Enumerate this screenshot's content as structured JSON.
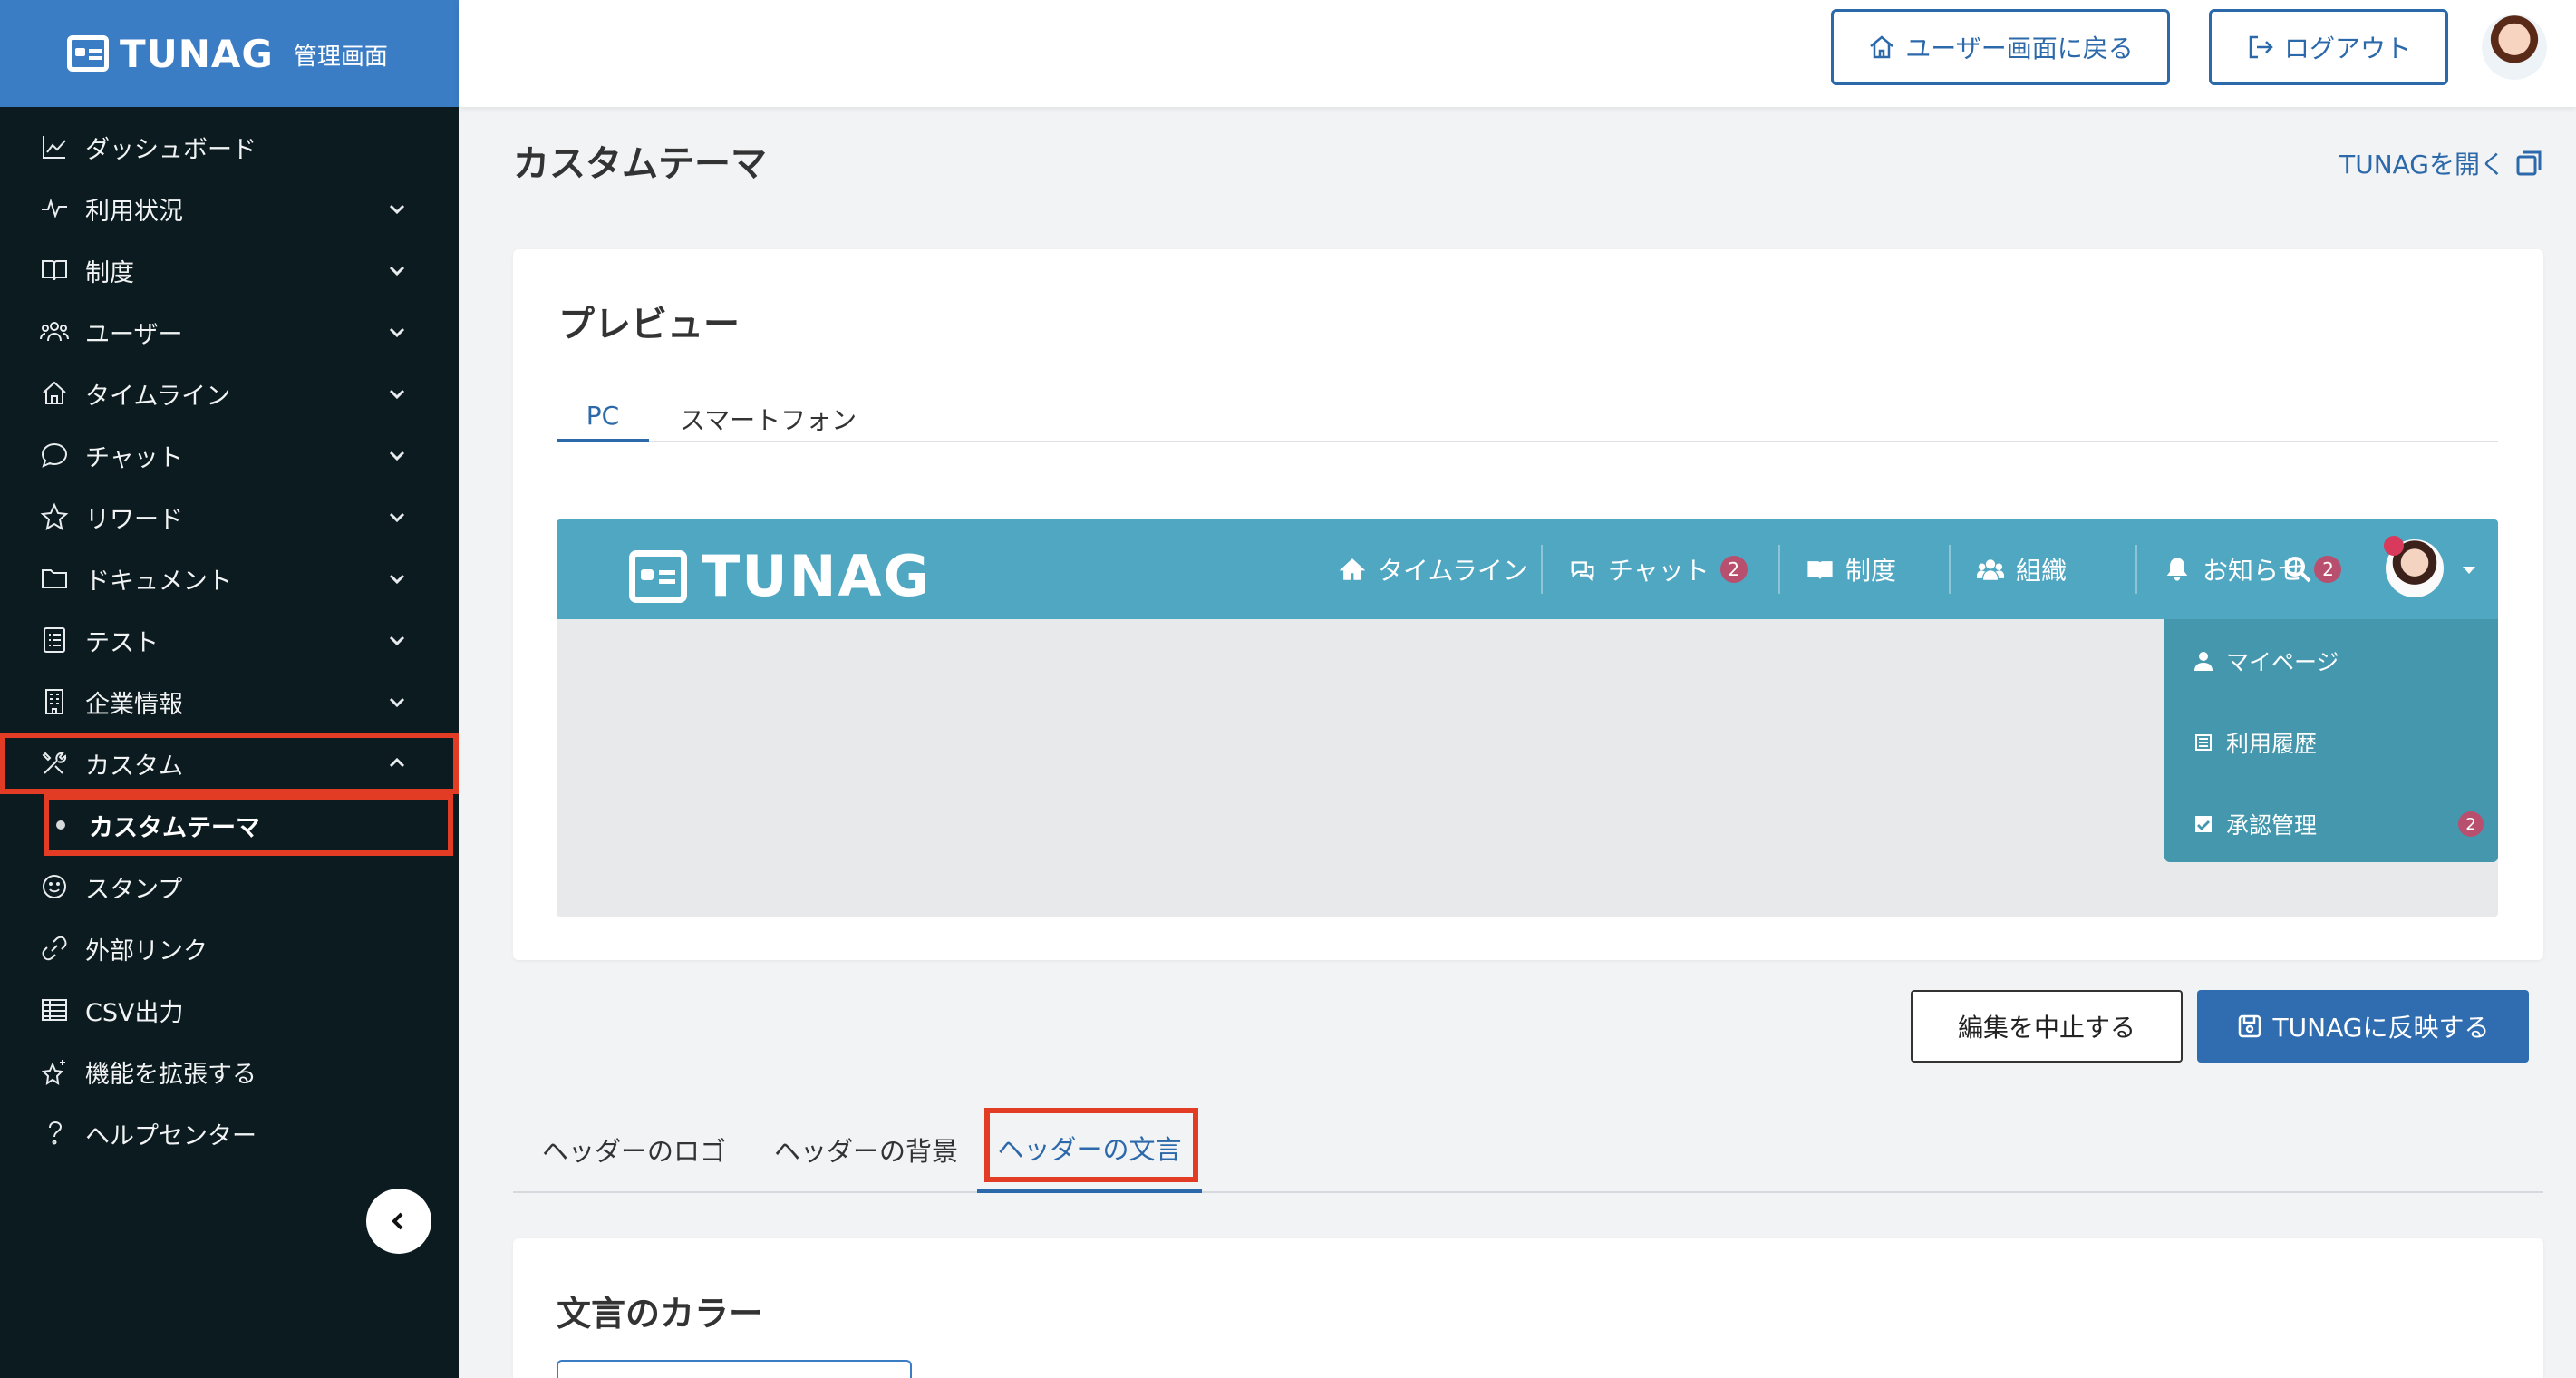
{
  "brand": {
    "logo": "TUNAG",
    "subtitle": "管理画面"
  },
  "sidebar": {
    "items": [
      {
        "label": "ダッシュボード",
        "icon": "chart-line-icon",
        "expandable": false
      },
      {
        "label": "利用状況",
        "icon": "pulse-icon",
        "expandable": true
      },
      {
        "label": "制度",
        "icon": "book-icon",
        "expandable": true
      },
      {
        "label": "ユーザー",
        "icon": "users-icon",
        "expandable": true
      },
      {
        "label": "タイムライン",
        "icon": "home-icon",
        "expandable": true
      },
      {
        "label": "チャット",
        "icon": "chat-bubble-icon",
        "expandable": true
      },
      {
        "label": "リワード",
        "icon": "star-icon",
        "expandable": true
      },
      {
        "label": "ドキュメント",
        "icon": "folder-icon",
        "expandable": true
      },
      {
        "label": "テスト",
        "icon": "checklist-icon",
        "expandable": true
      },
      {
        "label": "企業情報",
        "icon": "building-icon",
        "expandable": true
      },
      {
        "label": "カスタム",
        "icon": "tools-icon",
        "expandable": true,
        "expanded": true
      },
      {
        "label": "スタンプ",
        "icon": "smile-icon",
        "expandable": false
      },
      {
        "label": "外部リンク",
        "icon": "link-icon",
        "expandable": false
      },
      {
        "label": "CSV出力",
        "icon": "table-icon",
        "expandable": false
      },
      {
        "label": "機能を拡張する",
        "icon": "sparkle-star-icon",
        "expandable": false
      },
      {
        "label": "ヘルプセンター",
        "icon": "question-icon",
        "expandable": false
      }
    ],
    "active_sub": "カスタムテーマ"
  },
  "topbar": {
    "user_screen_label": "ユーザー画面に戻る",
    "logout_label": "ログアウト"
  },
  "page": {
    "title": "カスタムテーマ",
    "open_link": "TUNAGを開く"
  },
  "preview": {
    "title": "プレビュー",
    "tabs": [
      "PC",
      "スマートフォン"
    ],
    "active_tab": "PC",
    "mock": {
      "logo": "TUNAG",
      "header_color": "#50a7c2",
      "menu_color": "#4597ad",
      "nav": [
        {
          "label": "タイムライン",
          "icon": "home-icon"
        },
        {
          "label": "チャット",
          "icon": "chat-icon",
          "badge": "2"
        },
        {
          "label": "制度",
          "icon": "book-icon"
        },
        {
          "label": "組織",
          "icon": "users-icon"
        },
        {
          "label": "お知らせ",
          "icon": "bell-icon",
          "badge": "2"
        }
      ],
      "menu": [
        {
          "label": "マイページ",
          "icon": "person-icon"
        },
        {
          "label": "利用履歴",
          "icon": "list-icon"
        },
        {
          "label": "承認管理",
          "icon": "check-square-icon",
          "badge": "2"
        }
      ]
    }
  },
  "actions": {
    "cancel": "編集を中止する",
    "apply": "TUNAGに反映する"
  },
  "settings": {
    "tabs": [
      "ヘッダーのロゴ",
      "ヘッダーの背景",
      "ヘッダーの文言"
    ],
    "active_tab": "ヘッダーの文言",
    "section_title": "文言のカラー"
  },
  "colors": {
    "brand_blue": "#3b7dc4",
    "sidebar_bg": "#0c1b1f",
    "highlight": "#e23d24",
    "accent": "#2c69aa"
  }
}
